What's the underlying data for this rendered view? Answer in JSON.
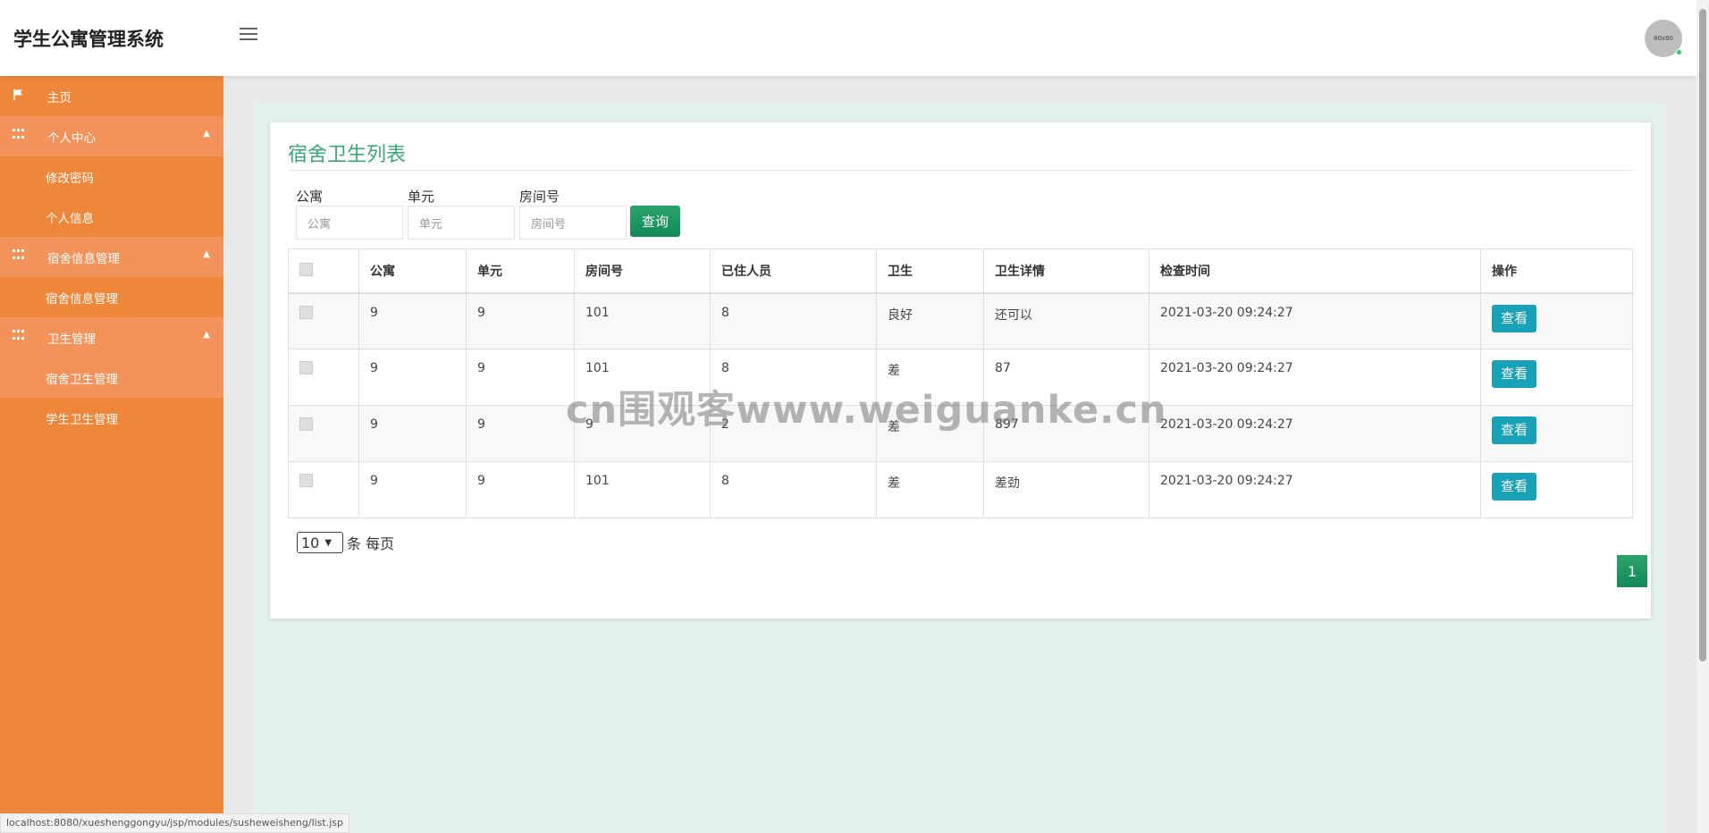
{
  "header": {
    "title": "学生公寓管理系统",
    "avatar_text": "80x80"
  },
  "sidebar": {
    "items": [
      {
        "label": "主页"
      },
      {
        "label": "个人中心"
      },
      {
        "label": "修改密码"
      },
      {
        "label": "个人信息"
      },
      {
        "label": "宿舍信息管理"
      },
      {
        "label": "宿舍信息管理"
      },
      {
        "label": "卫生管理"
      },
      {
        "label": "宿舍卫生管理"
      },
      {
        "label": "学生卫生管理"
      }
    ]
  },
  "page": {
    "title": "宿舍卫生列表"
  },
  "filters": {
    "apartment_label": "公寓",
    "apartment_placeholder": "公寓",
    "unit_label": "单元",
    "unit_placeholder": "单元",
    "room_label": "房间号",
    "room_placeholder": "房间号",
    "search_button": "查询"
  },
  "table": {
    "headers": [
      "公寓",
      "单元",
      "房间号",
      "已住人员",
      "卫生",
      "卫生详情",
      "检查时间",
      "操作"
    ],
    "view_label": "查看",
    "rows": [
      {
        "apartment": "9",
        "unit": "9",
        "room": "101",
        "residents": "8",
        "hygiene": "良好",
        "detail": "还可以",
        "time": "2021-03-20 09:24:27"
      },
      {
        "apartment": "9",
        "unit": "9",
        "room": "101",
        "residents": "8",
        "hygiene": "差",
        "detail": "87",
        "time": "2021-03-20 09:24:27"
      },
      {
        "apartment": "9",
        "unit": "9",
        "room": "9",
        "residents": "2",
        "hygiene": "差",
        "detail": "897",
        "time": "2021-03-20 09:24:27"
      },
      {
        "apartment": "9",
        "unit": "9",
        "room": "101",
        "residents": "8",
        "hygiene": "差",
        "detail": "差劲",
        "time": "2021-03-20 09:24:27"
      }
    ]
  },
  "pagination": {
    "page_size": "10",
    "page_size_suffix": "条 每页",
    "current_page": "1"
  },
  "watermark": "cn围观客www.weiguanke.cn",
  "status_url": "localhost:8080/xueshenggongyu/jsp/modules/susheweisheng/list.jsp",
  "colors": {
    "sidebar": "#ef873a",
    "accent_green": "#2aa36b",
    "view_button": "#17a2b8"
  }
}
